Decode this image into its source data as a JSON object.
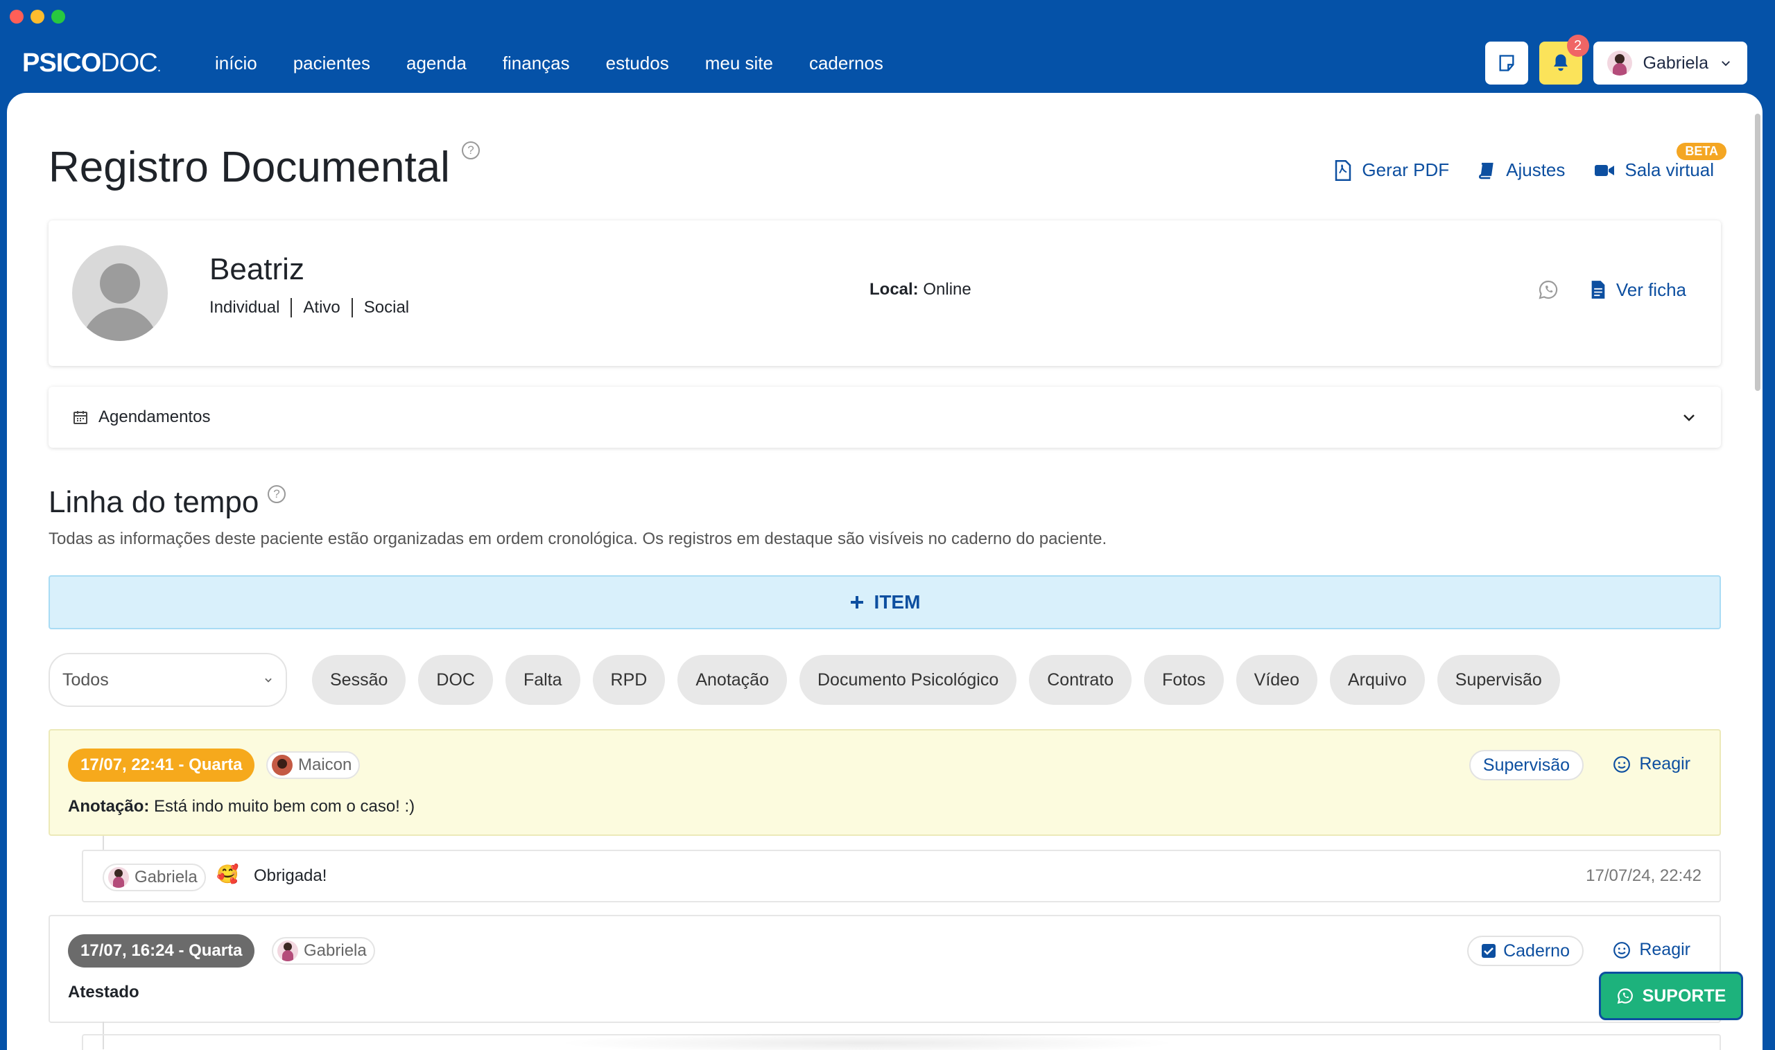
{
  "app": {
    "logo_main": "PSICO",
    "logo_doc": "DOC",
    "logo_suffix": "."
  },
  "nav": {
    "items": [
      "início",
      "pacientes",
      "agenda",
      "finanças",
      "estudos",
      "meu site",
      "cadernos"
    ],
    "notification_count": "2",
    "user_name": "Gabriela"
  },
  "page": {
    "title": "Registro Documental",
    "actions": {
      "pdf": "Gerar PDF",
      "ajustes": "Ajustes",
      "sala": "Sala virtual",
      "beta": "BETA"
    }
  },
  "patient": {
    "name": "Beatriz",
    "tags": [
      "Individual",
      "Ativo",
      "Social"
    ],
    "local_label": "Local:",
    "local_value": "Online",
    "ver_ficha": "Ver ficha"
  },
  "agendamentos": {
    "label": "Agendamentos"
  },
  "timeline": {
    "title": "Linha do tempo",
    "description": "Todas as informações deste paciente estão organizadas em ordem cronológica. Os registros em destaque são visíveis no caderno do paciente.",
    "add_item": "ITEM",
    "filter_select": "Todos",
    "chips": [
      "Sessão",
      "DOC",
      "Falta",
      "RPD",
      "Anotação",
      "Documento Psicológico",
      "Contrato",
      "Fotos",
      "Vídeo",
      "Arquivo",
      "Supervisão"
    ]
  },
  "entries": [
    {
      "date": "17/07, 22:41 - Quarta",
      "date_color": "#f6a91c",
      "author": "Maicon",
      "tag": "Supervisão",
      "react": "Reagir",
      "text_label": "Anotação:",
      "text": "Está indo muito bem com o caso! :)"
    },
    {
      "date": "17/07, 16:24 - Quarta",
      "date_color": "#6b6b6b",
      "author": "Gabriela",
      "tag": "Caderno",
      "react": "Reagir",
      "text": "Atestado"
    }
  ],
  "reply": {
    "author": "Gabriela",
    "emoji": "🥰",
    "text": "Obrigada!",
    "timestamp": "17/07/24, 22:42"
  },
  "support": {
    "label": "SUPORTE"
  },
  "colors": {
    "brand_blue": "#0552a8",
    "link_blue": "#0d4fa0",
    "bell_yellow": "#fbe35a",
    "support_green": "#1db27c"
  }
}
